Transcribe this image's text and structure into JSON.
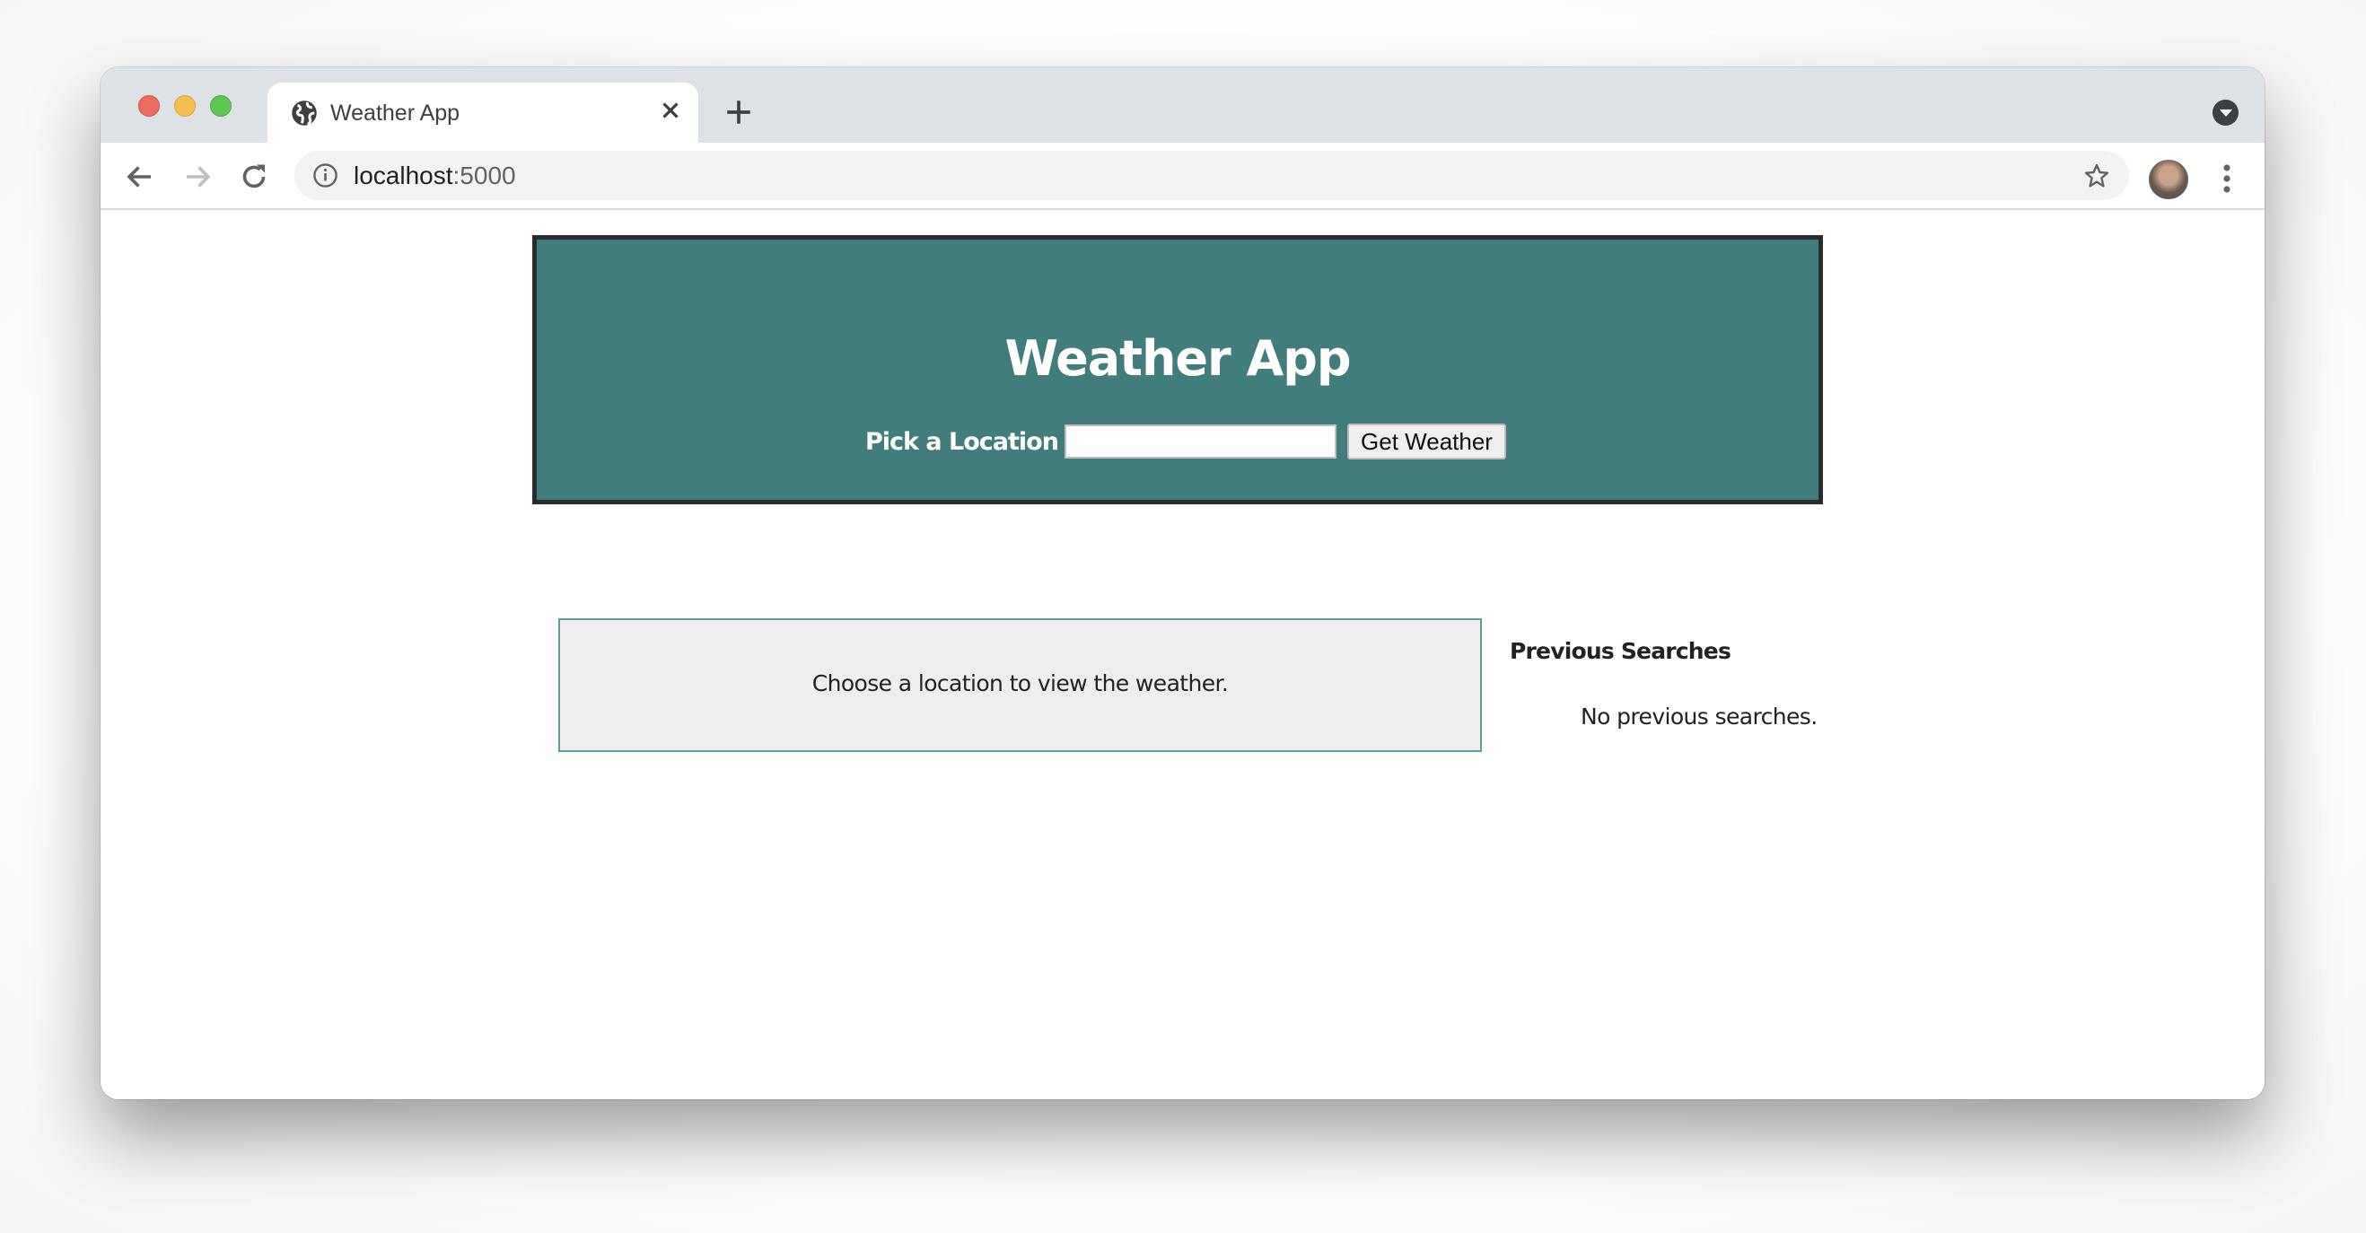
{
  "browser": {
    "tab": {
      "title": "Weather App",
      "favicon": "globe-icon",
      "close_icon": "close-icon"
    },
    "new_tab_icon": "plus-icon",
    "profile_dropdown_icon": "chevron-down-circle-icon",
    "nav": {
      "back_icon": "arrow-left-icon",
      "forward_icon": "arrow-right-icon",
      "reload_icon": "reload-icon"
    },
    "address_bar": {
      "info_icon": "info-icon",
      "host": "localhost",
      "port": ":5000",
      "bookmark_icon": "star-icon"
    },
    "avatar_icon": "profile-avatar",
    "menu_icon": "kebab-menu-icon"
  },
  "colors": {
    "header_bg": "#417d7d",
    "header_border": "#2b2b2b",
    "result_bg": "#eeeeee",
    "result_border": "#5f9c9c"
  },
  "app": {
    "title": "Weather App",
    "search": {
      "label": "Pick a Location",
      "input_value": "",
      "input_placeholder": "",
      "button_label": "Get Weather"
    },
    "result": {
      "message": "Choose a location to view the weather."
    },
    "previous_searches": {
      "heading": "Previous Searches",
      "empty_message": "No previous searches.",
      "items": []
    }
  }
}
